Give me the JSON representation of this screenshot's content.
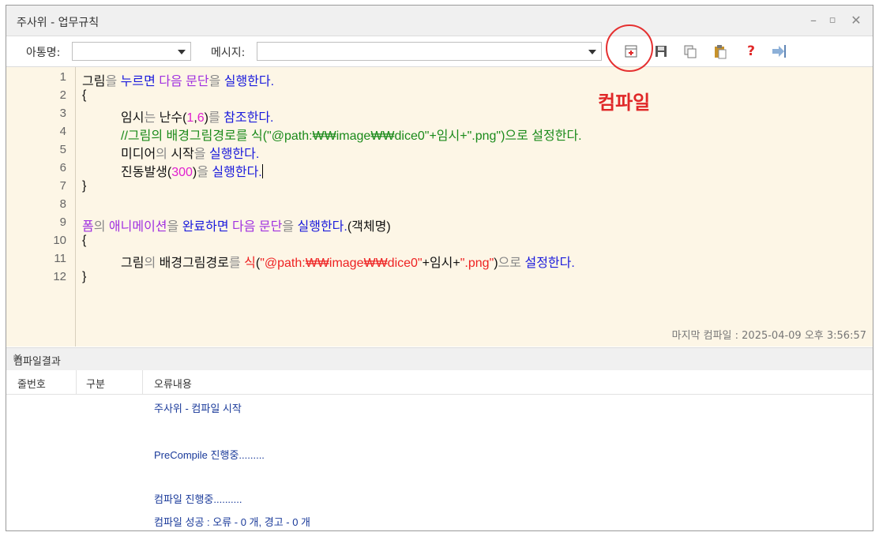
{
  "window": {
    "title": "주사위 - 업무규칙"
  },
  "toolbar": {
    "object_label": "아통명:",
    "object_value": "",
    "message_label": "메시지:",
    "message_value": ""
  },
  "annotation": {
    "text": "컴파일"
  },
  "editor": {
    "line_numbers": [
      "1",
      "2",
      "3",
      "4",
      "5",
      "6",
      "7",
      "8",
      "9",
      "10",
      "11",
      "12"
    ],
    "last_compile": "마지막 컴파일 : 2025-04-09 오후 3:56:57",
    "tokens": {
      "l1": [
        "그림",
        "을 ",
        "누르면 ",
        "다음 문단",
        "을 ",
        "실행한다."
      ],
      "l2": "{",
      "l3": [
        "임시",
        "는 ",
        "난수(",
        "1",
        ",",
        "6",
        ")",
        "를 ",
        "참조한다."
      ],
      "l4": "//그림의 배경그림경로를 식(\"@path:₩₩image₩₩dice0\"+임시+\".png\")으로 설정한다.",
      "l5": [
        "미디어",
        "의 ",
        "시작",
        "을 ",
        "실행한다."
      ],
      "l6": [
        "진동발생(",
        "300",
        ")",
        "을 ",
        "실행한다."
      ],
      "l7": "}",
      "l9": [
        "폼",
        "의 ",
        "애니메이션",
        "을 ",
        "완료하면 ",
        "다음 문단",
        "을 ",
        "실행한다.",
        "(객체명)"
      ],
      "l10": "{",
      "l11": [
        "그림",
        "의 ",
        "배경그림경로",
        "를 ",
        "식",
        "(",
        "\"@path:₩₩image₩₩dice0\"",
        "+임시+",
        "\".png\"",
        ")",
        "으로 ",
        "설정한다."
      ],
      "l12": "}"
    }
  },
  "results": {
    "title": "컴파일결과",
    "columns": [
      "줄번호",
      "구분",
      "오류내용"
    ],
    "messages": [
      "주사위 - 컴파일 시작",
      "PreCompile 진행중.........",
      "컴파일 진행중..........",
      "컴파일 성공 : 오류 - 0 개, 경고 - 0 개"
    ]
  },
  "icons": [
    "compile-icon",
    "save-icon",
    "copy-icon",
    "paste-icon",
    "help-icon",
    "exit-icon"
  ],
  "colors": {
    "editor_bg": "#fdf6e6",
    "keyword": "#1a1adc",
    "object": "#a030e0",
    "string": "#ee2222",
    "number": "#e020d0",
    "comment": "#1a8a1a",
    "annotation": "#e02828"
  }
}
